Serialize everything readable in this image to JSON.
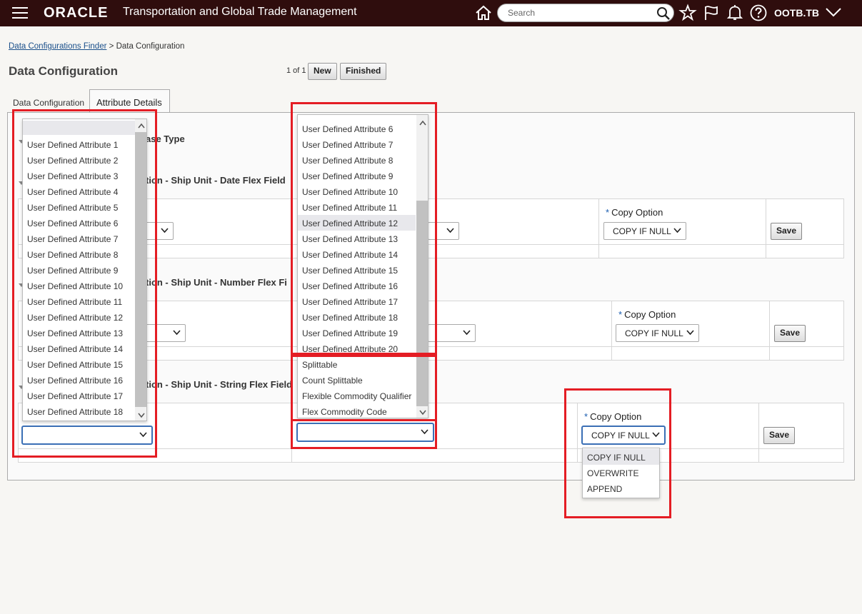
{
  "header": {
    "logo": "ORACLE",
    "app_title": "Transportation and Global Trade Management",
    "search_placeholder": "Search",
    "user": "OOTB.TB"
  },
  "breadcrumb": {
    "link": "Data Configurations Finder",
    "separator": ">",
    "current": "Data Configuration"
  },
  "page": {
    "title": "Data Configuration",
    "pager": "1 of 1",
    "new_label": "New",
    "finished_label": "Finished"
  },
  "tabs": [
    {
      "label": "Data Configuration"
    },
    {
      "label": "Attribute Details"
    }
  ],
  "sections": {
    "base_type_partial": "ase Type",
    "date_partial": "tion - Ship Unit - Date Flex Field",
    "number_partial": "tion - Ship Unit - Number Flex Fi",
    "string_partial": "tion - Ship Unit - String Flex Field"
  },
  "copy_option_label": "Copy Option",
  "copy_option_value": "COPY IF NULL",
  "save_label": "Save",
  "left_dropdown": {
    "items": [
      "",
      "User Defined Attribute 1",
      "User Defined Attribute 2",
      "User Defined Attribute 3",
      "User Defined Attribute 4",
      "User Defined Attribute 5",
      "User Defined Attribute 6",
      "User Defined Attribute 7",
      "User Defined Attribute 8",
      "User Defined Attribute 9",
      "User Defined Attribute 10",
      "User Defined Attribute 11",
      "User Defined Attribute 12",
      "User Defined Attribute 13",
      "User Defined Attribute 14",
      "User Defined Attribute 15",
      "User Defined Attribute 16",
      "User Defined Attribute 17",
      "User Defined Attribute 18"
    ],
    "selected_value": ""
  },
  "middle_dropdown": {
    "items": [
      "User Defined Attribute 6",
      "User Defined Attribute 7",
      "User Defined Attribute 8",
      "User Defined Attribute 9",
      "User Defined Attribute 10",
      "User Defined Attribute 11",
      "User Defined Attribute 12",
      "User Defined Attribute 13",
      "User Defined Attribute 14",
      "User Defined Attribute 15",
      "User Defined Attribute 16",
      "User Defined Attribute 17",
      "User Defined Attribute 18",
      "User Defined Attribute 19",
      "User Defined Attribute 20",
      "Splittable",
      "Count Splittable",
      "Flexible Commodity Qualifier",
      "Flex Commodity Code"
    ],
    "highlighted": "User Defined Attribute 12",
    "selected_value": ""
  },
  "copy_option_dropdown": {
    "items": [
      "COPY IF NULL",
      "OVERWRITE",
      "APPEND"
    ],
    "highlighted": "COPY IF NULL"
  },
  "colors": {
    "topbar": "#2f0d0d",
    "highlight_box": "#e41d24",
    "link": "#1a4f8a",
    "required_star": "#1a5db0"
  },
  "icons": [
    "menu-icon",
    "home-icon",
    "search-icon",
    "star-icon",
    "flag-icon",
    "bell-icon",
    "help-icon",
    "chevron-down-icon"
  ]
}
